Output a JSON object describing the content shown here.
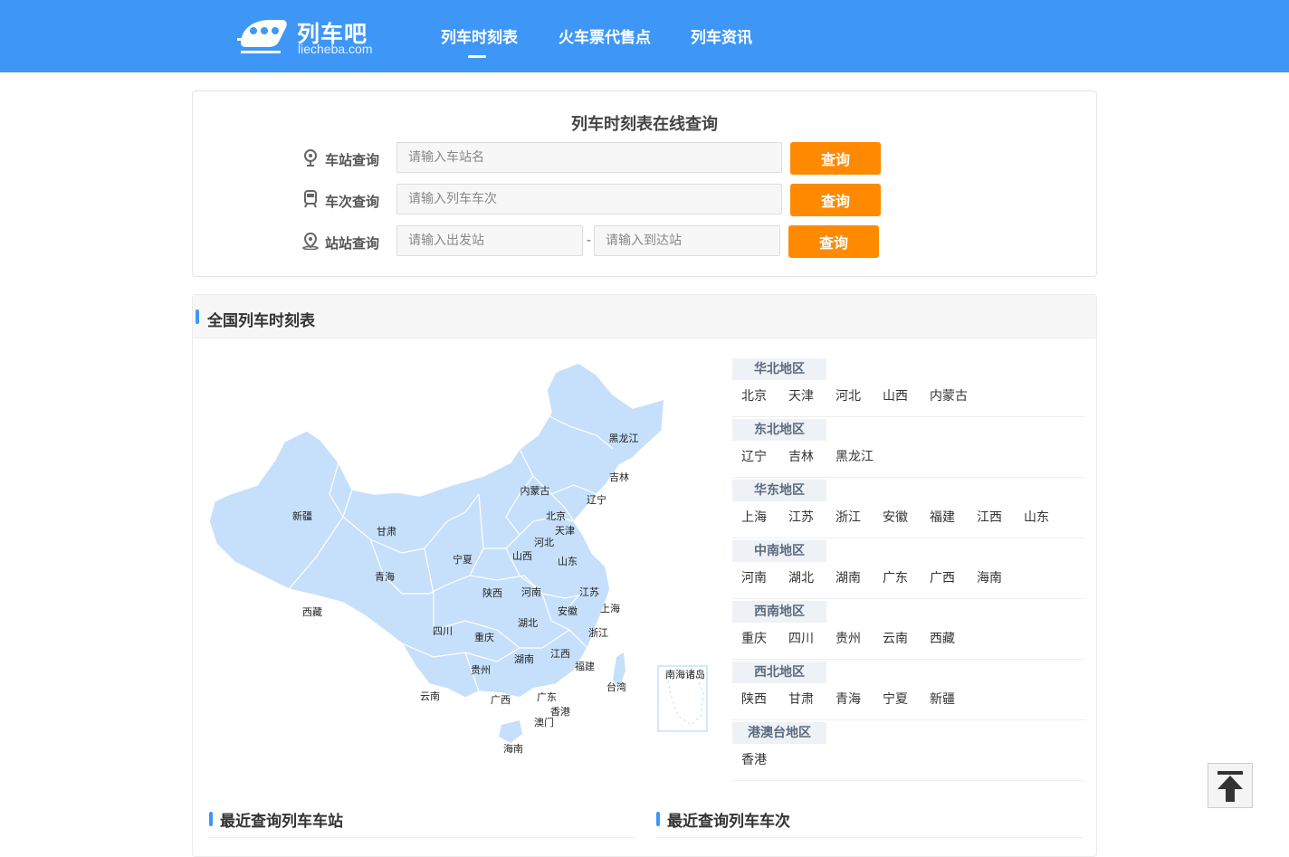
{
  "header": {
    "brand": "列车吧",
    "domain": "liecheba.com",
    "nav": [
      {
        "label": "列车时刻表",
        "active": true
      },
      {
        "label": "火车票代售点",
        "active": false
      },
      {
        "label": "列车资讯",
        "active": false
      }
    ]
  },
  "search": {
    "title": "列车时刻表在线查询",
    "station": {
      "label": "车站查询",
      "placeholder": "请输入车站名",
      "button": "查询"
    },
    "train": {
      "label": "车次查询",
      "placeholder": "请输入列车车次",
      "button": "查询"
    },
    "route": {
      "label": "站站查询",
      "from_placeholder": "请输入出发站",
      "separator": "-",
      "to_placeholder": "请输入到达站",
      "button": "查询"
    }
  },
  "national": {
    "title": "全国列车时刻表",
    "map_labels": [
      "黑龙江",
      "吉林",
      "辽宁",
      "内蒙古",
      "北京",
      "天津",
      "河北",
      "山西",
      "山东",
      "新疆",
      "甘肃",
      "宁夏",
      "青海",
      "陕西",
      "河南",
      "江苏",
      "上海",
      "安徽",
      "湖北",
      "浙江",
      "西藏",
      "四川",
      "重庆",
      "湖南",
      "江西",
      "福建",
      "贵州",
      "台湾",
      "云南",
      "广西",
      "广东",
      "香港",
      "澳门",
      "海南",
      "南海诸岛"
    ],
    "regions": [
      {
        "name": "华北地区",
        "items": [
          "北京",
          "天津",
          "河北",
          "山西",
          "内蒙古"
        ]
      },
      {
        "name": "东北地区",
        "items": [
          "辽宁",
          "吉林",
          "黑龙江"
        ]
      },
      {
        "name": "华东地区",
        "items": [
          "上海",
          "江苏",
          "浙江",
          "安徽",
          "福建",
          "江西",
          "山东"
        ]
      },
      {
        "name": "中南地区",
        "items": [
          "河南",
          "湖北",
          "湖南",
          "广东",
          "广西",
          "海南"
        ]
      },
      {
        "name": "西南地区",
        "items": [
          "重庆",
          "四川",
          "贵州",
          "云南",
          "西藏"
        ]
      },
      {
        "name": "西北地区",
        "items": [
          "陕西",
          "甘肃",
          "青海",
          "宁夏",
          "新疆"
        ]
      },
      {
        "name": "港澳台地区",
        "items": [
          "香港"
        ]
      }
    ]
  },
  "recent": {
    "stations_title": "最近查询列车车站",
    "trains_title": "最近查询列车车次"
  },
  "colors": {
    "header": "#3e97f7",
    "button": "#ff8a00",
    "map_fill": "#c6e0fb"
  }
}
